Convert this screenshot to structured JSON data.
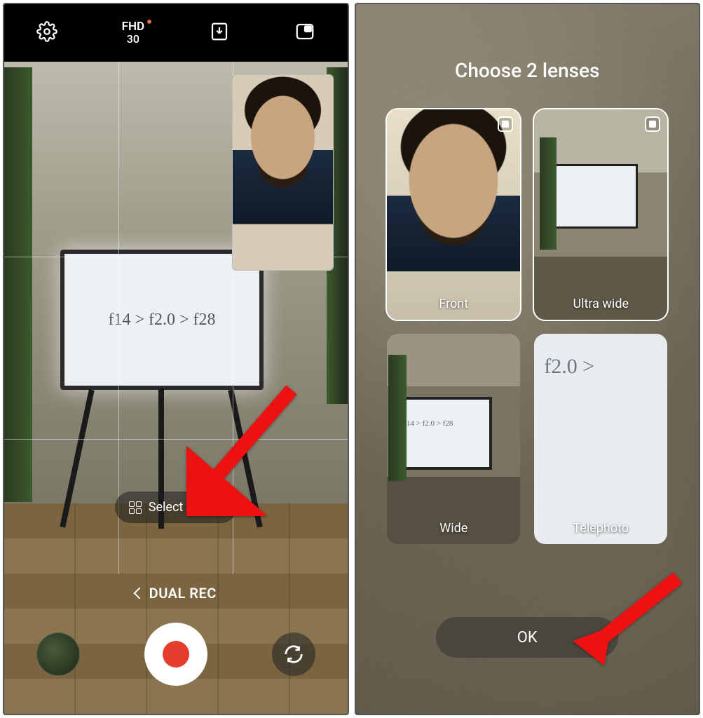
{
  "left": {
    "topbar": {
      "resolution_main": "FHD",
      "resolution_sub": "30"
    },
    "whiteboard_text": "f14 > f2.0 > f28",
    "select_lenses_label": "Select lenses",
    "mode_label": "DUAL REC"
  },
  "right": {
    "title": "Choose 2 lenses",
    "lenses": {
      "front": {
        "label": "Front",
        "selected": true
      },
      "ultra_wide": {
        "label": "Ultra wide",
        "selected": true
      },
      "wide": {
        "label": "Wide",
        "selected": false,
        "wb_text": "f14 > f2.0 > f28"
      },
      "telephoto": {
        "label": "Telephoto",
        "selected": false,
        "wb_text": "f2.0 >"
      }
    },
    "ok_label": "OK"
  }
}
